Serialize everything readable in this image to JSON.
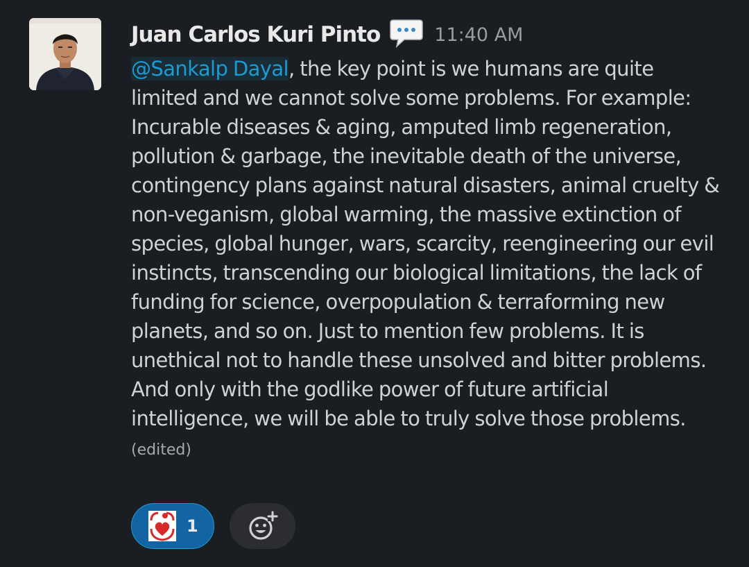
{
  "message": {
    "author": "Juan Carlos Kuri Pinto",
    "author_status_icon": "speech-balloon-icon",
    "timestamp": "11:40 AM",
    "mention": "@Sankalp Dayal",
    "body": ", the key point is we humans are quite limited and we cannot solve some problems. For example: Incurable diseases & aging, amputed limb regeneration, pollution & garbage, the inevitable death of the universe, contingency plans against natural disasters, animal cruelty & non-veganism, global warming, the massive extinction of species, global hunger, wars, scarcity, reengineering our evil instincts, transcending our biological limitations, the lack of funding for science, overpopulation & terraforming new planets, and so on. Just to mention few problems. It is unethical not to handle these unsolved and bitter problems. And only with the godlike power of future artificial intelligence, we will be able to truly solve those problems.",
    "edited_label": "(edited)"
  },
  "reactions": [
    {
      "emoji": "heart-logo-icon",
      "count": "1",
      "selected": true
    }
  ],
  "add_reaction": {
    "icon": "add-reaction-icon"
  },
  "colors": {
    "background": "#1a1d21",
    "text": "#d1d2d3",
    "mention": "#1d9bd1",
    "reaction_selected": "#1264a3",
    "add_reaction_bg": "#2c2d30"
  }
}
